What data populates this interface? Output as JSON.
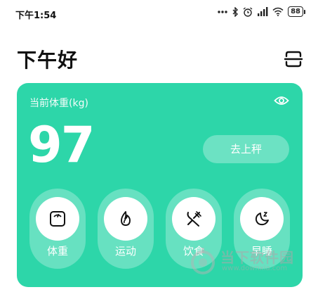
{
  "status_bar": {
    "time": "下午1:54",
    "battery": "88",
    "icons": [
      "more-dots-icon",
      "bluetooth-icon",
      "alarm-icon",
      "signal-icon",
      "wifi-icon",
      "battery-icon"
    ]
  },
  "header": {
    "greeting": "下午好",
    "scan_icon": "scan-icon"
  },
  "weight_card": {
    "label": "当前体重(kg)",
    "value": "97",
    "action_button": "去上秤",
    "eye_icon": "eye-icon",
    "accent_color": "#2dd6a9"
  },
  "quick_actions": [
    {
      "label": "体重",
      "icon": "scale-icon"
    },
    {
      "label": "运动",
      "icon": "flame-icon"
    },
    {
      "label": "饮食",
      "icon": "fork-knife-icon"
    },
    {
      "label": "早睡",
      "icon": "moon-sleep-icon"
    }
  ],
  "watermark": {
    "text": "当下软件园",
    "url": "www.downxia.com"
  }
}
